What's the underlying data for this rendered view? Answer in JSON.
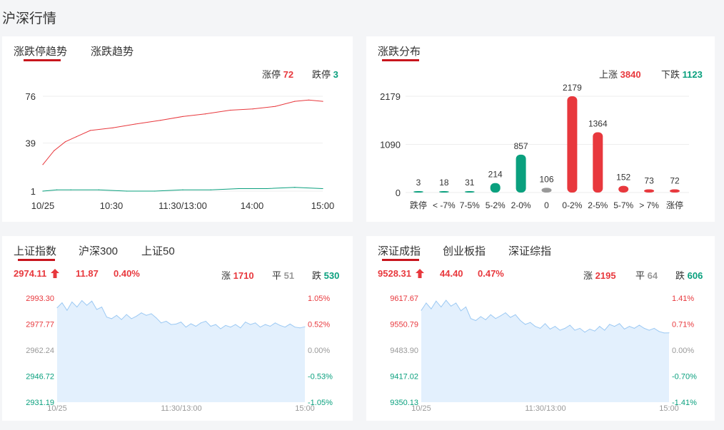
{
  "page_title": "沪深行情",
  "colors": {
    "up": "#e8383d",
    "down": "#0aa07e",
    "flat": "#999999",
    "tab_underline": "#c8151d",
    "area_fill": "#e3f0fd",
    "area_line": "#9cc9f3"
  },
  "limit_panel": {
    "tabs": [
      {
        "label": "涨跌停趋势",
        "active": true
      },
      {
        "label": "涨跌趋势",
        "active": false
      }
    ],
    "up_label": "涨停",
    "up_value": "72",
    "down_label": "跌停",
    "down_value": "3",
    "chart_data": {
      "type": "line",
      "x_ticks": [
        "10/25",
        "10:30",
        "11:30/13:00",
        "14:00",
        "15:00"
      ],
      "y_ticks": [
        "76",
        "39",
        "1"
      ],
      "ylim": [
        1,
        76
      ],
      "series": [
        {
          "name": "涨停",
          "color": "#e8383d",
          "x": [
            0,
            0.04,
            0.08,
            0.12,
            0.17,
            0.25,
            0.33,
            0.42,
            0.5,
            0.58,
            0.67,
            0.75,
            0.83,
            0.9,
            0.95,
            1.0
          ],
          "values": [
            22,
            33,
            40,
            44,
            49,
            51,
            54,
            57,
            60,
            62,
            65,
            66,
            68,
            72,
            73,
            72
          ]
        },
        {
          "name": "跌停",
          "color": "#0aa07e",
          "x": [
            0,
            0.05,
            0.1,
            0.2,
            0.3,
            0.4,
            0.5,
            0.6,
            0.7,
            0.8,
            0.9,
            1.0
          ],
          "values": [
            1,
            2,
            2,
            2,
            1,
            1,
            2,
            2,
            3,
            3,
            4,
            3
          ]
        }
      ]
    }
  },
  "dist_panel": {
    "tabs": [
      {
        "label": "涨跌分布",
        "active": true
      }
    ],
    "up_label": "上涨",
    "up_value": "3840",
    "down_label": "下跌",
    "down_value": "1123",
    "chart_data": {
      "type": "bar",
      "categories": [
        "跌停",
        "< -7%",
        "7-5%",
        "5-2%",
        "2-0%",
        "0",
        "0-2%",
        "2-5%",
        "5-7%",
        "> 7%",
        "涨停"
      ],
      "values": [
        3,
        18,
        31,
        214,
        857,
        106,
        2179,
        1364,
        152,
        73,
        72
      ],
      "bar_colors": [
        "#0aa07e",
        "#0aa07e",
        "#0aa07e",
        "#0aa07e",
        "#0aa07e",
        "#999999",
        "#e8383d",
        "#e8383d",
        "#e8383d",
        "#e8383d",
        "#e8383d"
      ],
      "y_ticks": [
        "2179",
        "1090",
        "0"
      ],
      "ylim": [
        0,
        2179
      ]
    }
  },
  "sh_panel": {
    "tabs": [
      {
        "label": "上证指数",
        "active": true
      },
      {
        "label": "沪深300",
        "active": false
      },
      {
        "label": "上证50",
        "active": false
      }
    ],
    "price": "2974.11",
    "change": "11.87",
    "change_pct": "0.40%",
    "up_label": "涨",
    "up_count": "1710",
    "flat_label": "平",
    "flat_count": "51",
    "down_label": "跌",
    "down_count": "530",
    "chart_data": {
      "type": "area",
      "x_ticks": [
        "10/25",
        "11:30/13:00",
        "15:00"
      ],
      "y_ticks_left": [
        "2993.30",
        "2977.77",
        "2962.24",
        "2946.72",
        "2931.19"
      ],
      "y_ticks_right": [
        "1.05%",
        "0.52%",
        "0.00%",
        "-0.53%",
        "-1.05%"
      ],
      "ylim": [
        2931.19,
        2993.3
      ],
      "x": [
        0,
        0.02,
        0.04,
        0.06,
        0.08,
        0.1,
        0.12,
        0.14,
        0.16,
        0.18,
        0.2,
        0.22,
        0.24,
        0.26,
        0.28,
        0.3,
        0.32,
        0.34,
        0.36,
        0.38,
        0.4,
        0.42,
        0.44,
        0.46,
        0.48,
        0.5,
        0.52,
        0.54,
        0.56,
        0.58,
        0.6,
        0.62,
        0.64,
        0.66,
        0.68,
        0.7,
        0.72,
        0.74,
        0.76,
        0.78,
        0.8,
        0.82,
        0.84,
        0.86,
        0.88,
        0.9,
        0.92,
        0.94,
        0.96,
        0.98,
        1.0
      ],
      "values": [
        2987.5,
        2990.5,
        2986.0,
        2991.0,
        2988.0,
        2991.8,
        2989.0,
        2991.5,
        2986.5,
        2988.0,
        2982.0,
        2981.0,
        2983.0,
        2980.5,
        2983.5,
        2981.0,
        2982.5,
        2984.5,
        2983.0,
        2984.0,
        2981.5,
        2978.5,
        2979.5,
        2977.5,
        2977.8,
        2979.0,
        2976.0,
        2978.0,
        2976.5,
        2978.5,
        2979.5,
        2976.5,
        2977.5,
        2975.0,
        2977.0,
        2976.0,
        2977.5,
        2975.5,
        2979.0,
        2977.5,
        2978.5,
        2976.0,
        2977.5,
        2976.5,
        2978.5,
        2977.0,
        2976.0,
        2977.8,
        2976.0,
        2975.5,
        2976.2
      ]
    }
  },
  "sz_panel": {
    "tabs": [
      {
        "label": "深证成指",
        "active": true
      },
      {
        "label": "创业板指",
        "active": false
      },
      {
        "label": "深证综指",
        "active": false
      }
    ],
    "price": "9528.31",
    "change": "44.40",
    "change_pct": "0.47%",
    "up_label": "涨",
    "up_count": "2195",
    "flat_label": "平",
    "flat_count": "64",
    "down_label": "跌",
    "down_count": "606",
    "chart_data": {
      "type": "area",
      "x_ticks": [
        "10/25",
        "11:30/13:00",
        "15:00"
      ],
      "y_ticks_left": [
        "9617.67",
        "9550.79",
        "9483.90",
        "9417.02",
        "9350.13"
      ],
      "y_ticks_right": [
        "1.41%",
        "0.71%",
        "0.00%",
        "-0.70%",
        "-1.41%"
      ],
      "ylim": [
        9350.13,
        9617.67
      ],
      "x": [
        0,
        0.02,
        0.04,
        0.06,
        0.08,
        0.1,
        0.12,
        0.14,
        0.16,
        0.18,
        0.2,
        0.22,
        0.24,
        0.26,
        0.28,
        0.3,
        0.32,
        0.34,
        0.36,
        0.38,
        0.4,
        0.42,
        0.44,
        0.46,
        0.48,
        0.5,
        0.52,
        0.54,
        0.56,
        0.58,
        0.6,
        0.62,
        0.64,
        0.66,
        0.68,
        0.7,
        0.72,
        0.74,
        0.76,
        0.78,
        0.8,
        0.82,
        0.84,
        0.86,
        0.88,
        0.9,
        0.92,
        0.94,
        0.96,
        0.98,
        1.0
      ],
      "values": [
        9586.0,
        9605.0,
        9590.0,
        9610.0,
        9595.0,
        9612.0,
        9597.0,
        9605.0,
        9585.0,
        9595.0,
        9565.0,
        9560.0,
        9570.0,
        9562.0,
        9575.0,
        9565.0,
        9572.0,
        9580.0,
        9568.0,
        9575.0,
        9560.0,
        9550.0,
        9555.0,
        9545.0,
        9540.0,
        9552.0,
        9538.0,
        9545.0,
        9535.0,
        9540.0,
        9548.0,
        9535.0,
        9540.0,
        9530.0,
        9538.0,
        9533.0,
        9545.0,
        9535.0,
        9550.0,
        9545.0,
        9552.0,
        9538.0,
        9545.0,
        9540.0,
        9548.0,
        9540.0,
        9535.0,
        9540.0,
        9532.0,
        9528.0,
        9528.3
      ]
    }
  }
}
